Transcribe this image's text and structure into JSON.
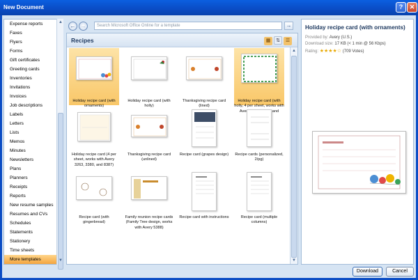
{
  "window": {
    "title": "New Document",
    "help_glyph": "?",
    "close_glyph": "✕"
  },
  "categories": [
    "Expense reports",
    "Faxes",
    "Flyers",
    "Forms",
    "Gift certificates",
    "Greeting cards",
    "Inventories",
    "Invitations",
    "Invoices",
    "Job descriptions",
    "Labels",
    "Letters",
    "Lists",
    "Memos",
    "Minutes",
    "Newsletters",
    "Plans",
    "Planners",
    "Receipts",
    "Reports",
    "New resume samples",
    "Resumes and CVs",
    "Schedules",
    "Statements",
    "Stationery",
    "Time sheets",
    "More templates"
  ],
  "selected_category": "More templates",
  "search": {
    "placeholder": "Search Microsoft Office Online for a template"
  },
  "center": {
    "heading": "Recipes"
  },
  "templates": [
    {
      "caption": "Holiday recipe card (with ornaments)",
      "selected": true
    },
    {
      "caption": "Holiday recipe card (with holly)"
    },
    {
      "caption": "Thanksgiving recipe card (lined)"
    },
    {
      "caption": "Holiday recipe card (with holly, 4 per sheet, works with Avery 3263, 3380, and 8387)",
      "selected": true
    },
    {
      "caption": "Holiday recipe card (4 per sheet, works with Avery 3263, 3380, and 8387)"
    },
    {
      "caption": "Thanksgiving recipe card (unlined)"
    },
    {
      "caption": "Recipe card (grapes design)"
    },
    {
      "caption": "Recipe cards (personalized, 2/pg)"
    },
    {
      "caption": "Recipe card (with gingerbread)"
    },
    {
      "caption": "Family reunion recipe cards (Family Tree design, works with Avery 5388)"
    },
    {
      "caption": "Recipe card with instructions"
    },
    {
      "caption": "Recipe card (multiple columns)"
    }
  ],
  "details": {
    "title": "Holiday recipe card (with ornaments)",
    "provided_by_label": "Provided by:",
    "provided_by": "Avery (U.S.)",
    "download_size_label": "Download size:",
    "download_size": "17 KB (< 1 min @ 56 Kbps)",
    "rating_label": "Rating:",
    "rating_stars": 4.5,
    "votes": "(709 Votes)"
  },
  "footer": {
    "download_label": "Download",
    "cancel_label": "Cancel"
  },
  "colors": {
    "title_bar": "#0a4cc4",
    "selection": "#f4a53e",
    "pane_border": "#a3bcd8"
  }
}
